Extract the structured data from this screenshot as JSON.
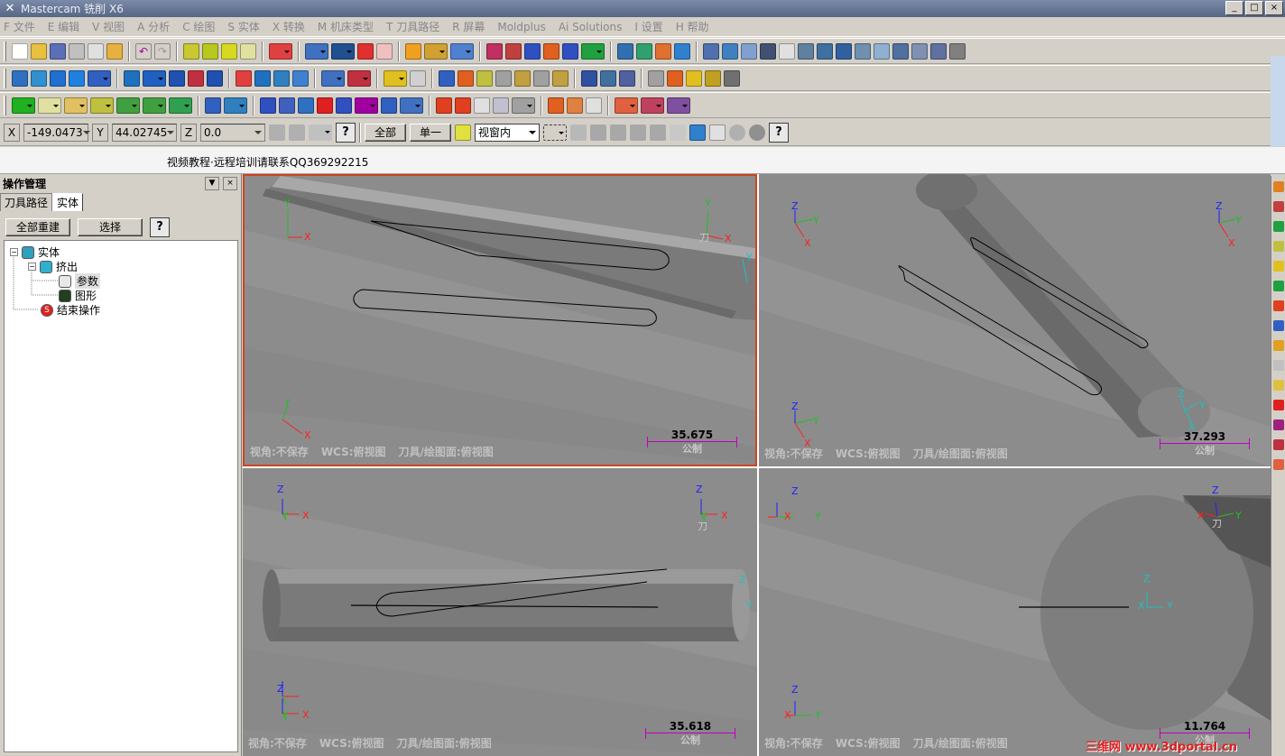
{
  "title": {
    "app": "Mastercam 铣削 X6"
  },
  "menu": [
    {
      "label": "F 文件"
    },
    {
      "label": "E 编辑"
    },
    {
      "label": "V 视图"
    },
    {
      "label": "A 分析"
    },
    {
      "label": "C 绘图"
    },
    {
      "label": "S 实体"
    },
    {
      "label": "X 转换"
    },
    {
      "label": "M 机床类型"
    },
    {
      "label": "T 刀具路径"
    },
    {
      "label": "R 屏幕"
    },
    {
      "label": "Moldplus"
    },
    {
      "label": "Ai Solutions"
    },
    {
      "label": "I 设置"
    },
    {
      "label": "H 帮助"
    }
  ],
  "coord": {
    "x_label": "X",
    "x_value": "-149.0473",
    "y_label": "Y",
    "y_value": "44.02745",
    "z_label": "Z",
    "z_value": "0.0",
    "all_button": "全部",
    "single_button": "单一",
    "select_mode": "视窗内"
  },
  "prompt": {
    "text": "视频教程·远程培训请联系QQ369292215"
  },
  "opmgr": {
    "title": "操作管理",
    "tabs": [
      "刀具路径",
      "实体"
    ],
    "rebuild_button": "全部重建",
    "select_button": "选择",
    "tree": {
      "root": "实体",
      "extrude": "挤出",
      "params": "参数",
      "shape": "图形",
      "end_op": "结束操作"
    }
  },
  "viewports": [
    {
      "id": "top-left",
      "view": "视角:不保存",
      "wcs": "WCS:俯视图",
      "plane": "刀具/绘图面:俯视图",
      "scale": "35.675",
      "unit": "公制"
    },
    {
      "id": "top-right",
      "view": "视角:不保存",
      "wcs": "WCS:俯视图",
      "plane": "刀具/绘图面:俯视图",
      "scale": "37.293",
      "unit": "公制"
    },
    {
      "id": "bottom-left",
      "view": "视角:不保存",
      "wcs": "WCS:俯视图",
      "plane": "刀具/绘图面:俯视图",
      "scale": "35.618",
      "unit": "公制"
    },
    {
      "id": "bottom-right",
      "view": "视角:不保存",
      "wcs": "WCS:俯视图",
      "plane": "刀具/绘图面:俯视图",
      "scale": "11.764",
      "unit": "公制"
    }
  ],
  "gnomon": {
    "x": "X",
    "y": "Y",
    "z": "Z",
    "tool": "刀"
  },
  "watermark": "三维网 www.3dportal.cn",
  "colors": {
    "axis_x": "#ff2020",
    "axis_y": "#20c020",
    "axis_z": "#2020ff",
    "scale_bar": "#c000c0",
    "active_border": "#cc4422"
  }
}
